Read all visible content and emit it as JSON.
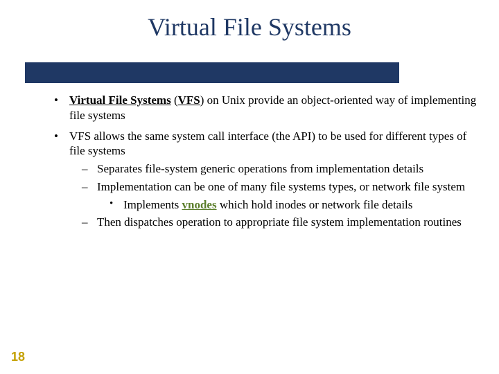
{
  "title": "Virtual File Systems",
  "bullets": {
    "b0": {
      "term": "Virtual File Systems",
      "abbr_open": " (",
      "abbr": "VFS",
      "abbr_close": ")",
      "rest": " on Unix provide an object-oriented way of implementing file systems"
    },
    "b1": "VFS allows the same system call interface (the API) to be used for different types of file systems",
    "b1_sub": {
      "s0": "Separates file-system generic operations from implementation details",
      "s1": "Implementation can be one of many file systems types, or network file system",
      "s1_sub": {
        "pre": "Implements ",
        "term": "vnodes",
        "post": " which hold inodes or network file details"
      },
      "s2": "Then dispatches operation to appropriate file system implementation routines"
    }
  },
  "page_number": "18"
}
